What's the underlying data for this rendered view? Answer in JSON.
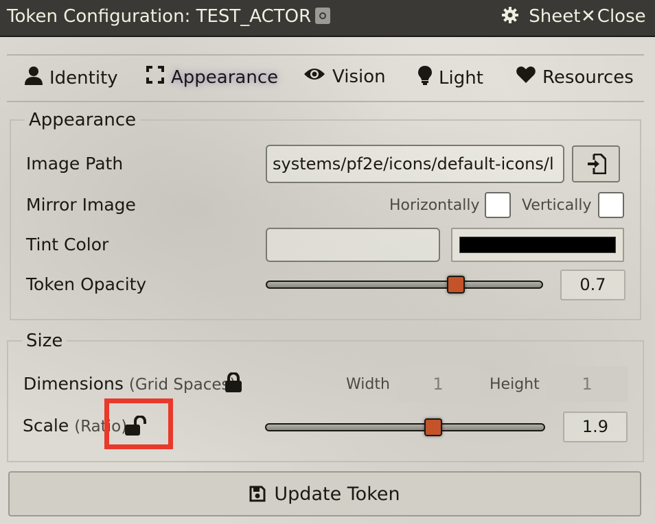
{
  "window": {
    "title": "Token Configuration: TEST_ACTOR",
    "sheet_label": "Sheet",
    "close_label": "Close",
    "close_glyph": "✕"
  },
  "tabs": [
    {
      "label": "Identity",
      "icon": "user-icon"
    },
    {
      "label": "Appearance",
      "icon": "expand-icon",
      "active": true
    },
    {
      "label": "Vision",
      "icon": "eye-icon"
    },
    {
      "label": "Light",
      "icon": "lightbulb-icon"
    },
    {
      "label": "Resources",
      "icon": "heart-icon"
    }
  ],
  "appearance": {
    "legend": "Appearance",
    "image_path_label": "Image Path",
    "image_path_value": "systems/pf2e/icons/default-icons/l",
    "mirror_label": "Mirror Image",
    "horizontally_label": "Horizontally",
    "vertically_label": "Vertically",
    "horizontally_checked": false,
    "vertically_checked": false,
    "tint_label": "Tint Color",
    "tint_value": "",
    "tint_swatch_color": "#000000",
    "opacity_label": "Token Opacity",
    "opacity_value": "0.7",
    "opacity_level": 0.7
  },
  "size": {
    "legend": "Size",
    "dimensions_label": "Dimensions",
    "dimensions_hint": "(Grid Spaces)",
    "width_label": "Width",
    "width_value": "1",
    "height_label": "Height",
    "height_value": "1",
    "scale_label": "Scale",
    "scale_hint": "(Ratio)",
    "scale_value": "1.9",
    "scale_range": [
      0.2,
      3
    ],
    "scale_locked": false
  },
  "footer": {
    "update_label": "Update Token"
  },
  "colors": {
    "accent": "#c4532a",
    "highlight": "#e8392a",
    "titlebar": "#3a3935"
  }
}
